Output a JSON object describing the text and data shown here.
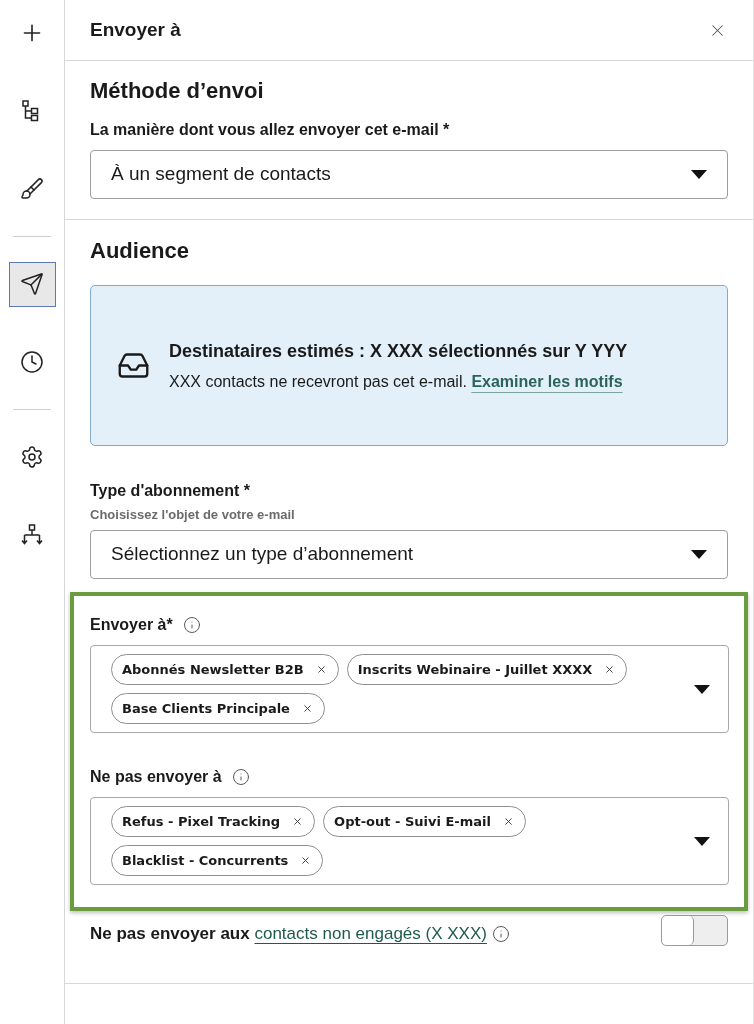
{
  "rail": [
    {
      "kind": "add",
      "selected": false
    },
    {
      "kind": "tree",
      "selected": false
    },
    {
      "kind": "brush",
      "selected": false
    },
    {
      "kind": "divider"
    },
    {
      "kind": "send",
      "selected": true
    },
    {
      "kind": "history",
      "selected": false
    },
    {
      "kind": "divider"
    },
    {
      "kind": "settings",
      "selected": false
    },
    {
      "kind": "hierarchy",
      "selected": false
    }
  ],
  "panel": {
    "title": "Envoyer à"
  },
  "method": {
    "heading": "Méthode d’envoi",
    "field": {
      "label": "La manière dont vous allez envoyer cet e-mail *",
      "value": "À un segment de contacts"
    }
  },
  "audience": {
    "heading": "Audience",
    "estimate": {
      "title": "Destinataires estimés : X XXX sélectionnés sur Y YYY",
      "text": "XXX contacts ne recevront pas cet e-mail.",
      "link": "Examiner les motifs"
    },
    "subscription": {
      "label": "Type d'abonnement *",
      "hint": "Choisissez l'objet de votre e-mail",
      "placeholder": "Sélectionnez un type d’abonnement"
    }
  },
  "recipients": {
    "highlighted": true,
    "include": {
      "label": "Envoyer à*",
      "chips": [
        "Abonnés Newsletter B2B",
        "Inscrits Webinaire - Juillet XXXX",
        "Base Clients Principale"
      ]
    },
    "exclude": {
      "label": "Ne pas envoyer à",
      "chips": [
        "Refus - Pixel Tracking",
        "Opt-out - Suivi E-mail",
        "Blacklist - Concurrents"
      ]
    }
  },
  "unengaged": {
    "label": "Ne pas envoyer aux",
    "link": "contacts non engagés (X XXX)",
    "on": false
  }
}
